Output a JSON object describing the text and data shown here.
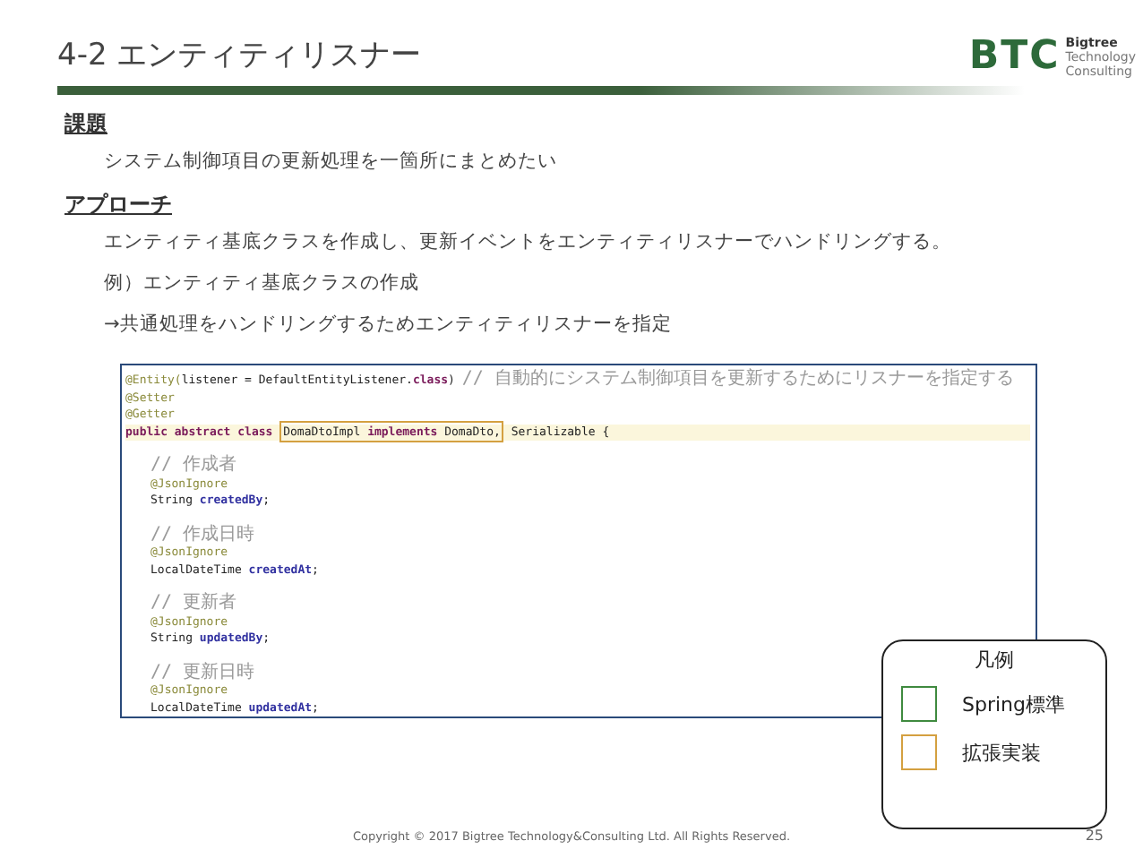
{
  "title": "4-2 エンティティリスナー",
  "logo": {
    "mark": "BTC",
    "lines": [
      "Bigtree",
      "Technology",
      "Consulting"
    ]
  },
  "sections": [
    {
      "heading": "課題",
      "items": [
        {
          "text": "システム制御項目の更新処理を一箇所にまとめたい"
        }
      ]
    },
    {
      "heading": "アプローチ",
      "items": [
        {
          "text": "エンティティ基底クラスを作成し、更新イベントをエンティティリスナーでハンドリングする。"
        },
        {
          "text": "例）エンティティ基底クラスの作成"
        },
        {
          "text": "→共通処理をハンドリングするためエンティティリスナーを指定"
        }
      ]
    }
  ],
  "code": {
    "lines": [
      {
        "kind": "code",
        "indented": false,
        "highlighted": false,
        "tokens": [
          {
            "kind": "annotation",
            "text": "@Entity("
          },
          {
            "kind": "plain",
            "text": "listener = DefaultEntityListener."
          },
          {
            "kind": "keyword",
            "text": "class"
          },
          {
            "kind": "plain",
            "text": ") "
          },
          {
            "kind": "comment",
            "text": "// 自動的にシステム制御項目を更新するためにリスナーを指定する"
          }
        ]
      },
      {
        "kind": "code",
        "indented": false,
        "highlighted": false,
        "tokens": [
          {
            "kind": "annotation",
            "text": "@Setter"
          }
        ]
      },
      {
        "kind": "code",
        "indented": false,
        "highlighted": false,
        "tokens": [
          {
            "kind": "annotation",
            "text": "@Getter"
          }
        ]
      },
      {
        "kind": "code",
        "indented": false,
        "highlighted": true,
        "tokens": [
          {
            "kind": "keyword",
            "text": "public abstract class "
          },
          {
            "kind": "frame",
            "color": "#d4a040",
            "parts": [
              {
                "kind": "plain",
                "text": "DomaDtoImpl "
              },
              {
                "kind": "keyword",
                "text": "implements "
              },
              {
                "kind": "plain",
                "text": "DomaDto,"
              }
            ]
          },
          {
            "kind": "plain",
            "text": " Serializable {"
          }
        ]
      },
      {
        "kind": "blank"
      },
      {
        "kind": "code",
        "indented": true,
        "highlighted": false,
        "tokens": [
          {
            "kind": "comment",
            "text": "// 作成者"
          }
        ]
      },
      {
        "kind": "code",
        "indented": true,
        "highlighted": false,
        "tokens": [
          {
            "kind": "annotation",
            "text": "@JsonIgnore"
          }
        ]
      },
      {
        "kind": "code",
        "indented": true,
        "highlighted": false,
        "tokens": [
          {
            "kind": "plain",
            "text": "String "
          },
          {
            "kind": "field",
            "text": "createdBy"
          },
          {
            "kind": "plain",
            "text": ";"
          }
        ]
      },
      {
        "kind": "blank"
      },
      {
        "kind": "code",
        "indented": true,
        "highlighted": false,
        "tokens": [
          {
            "kind": "comment",
            "text": "// 作成日時"
          }
        ]
      },
      {
        "kind": "code",
        "indented": true,
        "highlighted": false,
        "tokens": [
          {
            "kind": "annotation",
            "text": "@JsonIgnore"
          }
        ]
      },
      {
        "kind": "code",
        "indented": true,
        "highlighted": false,
        "tokens": [
          {
            "kind": "plain",
            "text": "LocalDateTime "
          },
          {
            "kind": "field",
            "text": "createdAt"
          },
          {
            "kind": "plain",
            "text": ";"
          }
        ]
      },
      {
        "kind": "blank"
      },
      {
        "kind": "code",
        "indented": true,
        "highlighted": false,
        "tokens": [
          {
            "kind": "comment",
            "text": "// 更新者"
          }
        ]
      },
      {
        "kind": "code",
        "indented": true,
        "highlighted": false,
        "tokens": [
          {
            "kind": "annotation",
            "text": "@JsonIgnore"
          }
        ]
      },
      {
        "kind": "code",
        "indented": true,
        "highlighted": false,
        "tokens": [
          {
            "kind": "plain",
            "text": "String "
          },
          {
            "kind": "field",
            "text": "updatedBy"
          },
          {
            "kind": "plain",
            "text": ";"
          }
        ]
      },
      {
        "kind": "blank"
      },
      {
        "kind": "code",
        "indented": true,
        "highlighted": false,
        "tokens": [
          {
            "kind": "comment",
            "text": "// 更新日時"
          }
        ]
      },
      {
        "kind": "code",
        "indented": true,
        "highlighted": false,
        "tokens": [
          {
            "kind": "annotation",
            "text": "@JsonIgnore"
          }
        ]
      },
      {
        "kind": "code",
        "indented": true,
        "highlighted": false,
        "tokens": [
          {
            "kind": "plain",
            "text": "LocalDateTime "
          },
          {
            "kind": "field",
            "text": "updatedAt"
          },
          {
            "kind": "plain",
            "text": ";"
          }
        ]
      }
    ]
  },
  "legend": {
    "title": "凡例",
    "items": [
      {
        "label": "Spring標準",
        "color": "#3f8a3f"
      },
      {
        "label": "拡張実装",
        "color": "#d4a040"
      }
    ]
  },
  "footer": {
    "copyright": "Copyright © 2017 Bigtree Technology&Consulting Ltd. All Rights Reserved.",
    "page": "25"
  }
}
